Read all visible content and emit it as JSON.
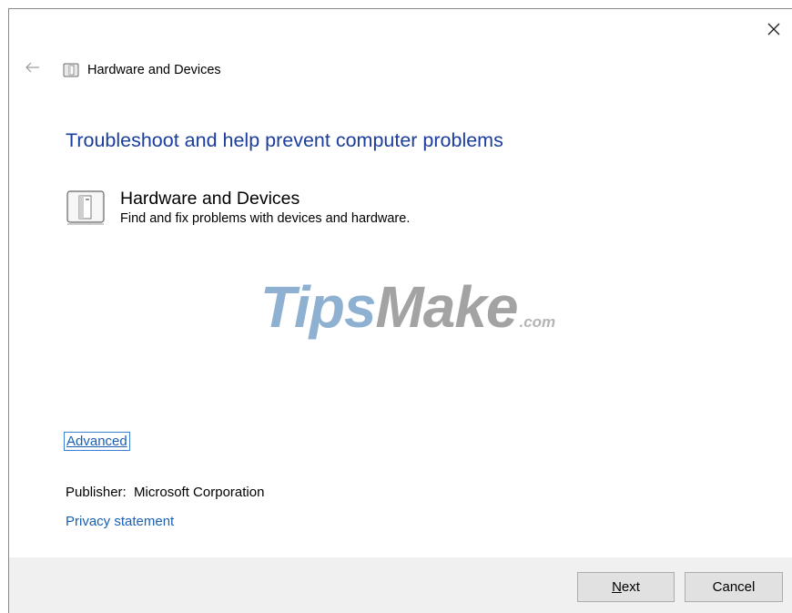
{
  "window": {
    "breadcrumb_title": "Hardware and Devices"
  },
  "main": {
    "heading": "Troubleshoot and help prevent computer problems",
    "item": {
      "name": "Hardware and Devices",
      "description": "Find and fix problems with devices and hardware.",
      "icon": "hardware-troubleshooter-icon"
    },
    "watermark": {
      "part1": "Tips",
      "part2": "Make",
      "part3": ".com"
    },
    "advanced_link": "Advanced",
    "publisher_label": "Publisher:",
    "publisher_value": "Microsoft Corporation",
    "privacy_link": "Privacy statement"
  },
  "footer": {
    "next_mnemonic": "N",
    "next_rest": "ext",
    "cancel_label": "Cancel"
  },
  "colors": {
    "heading": "#1a3d9e",
    "link": "#1a5fb4",
    "footer_bg": "#f0f0f0",
    "button_bg": "#e1e1e1"
  }
}
